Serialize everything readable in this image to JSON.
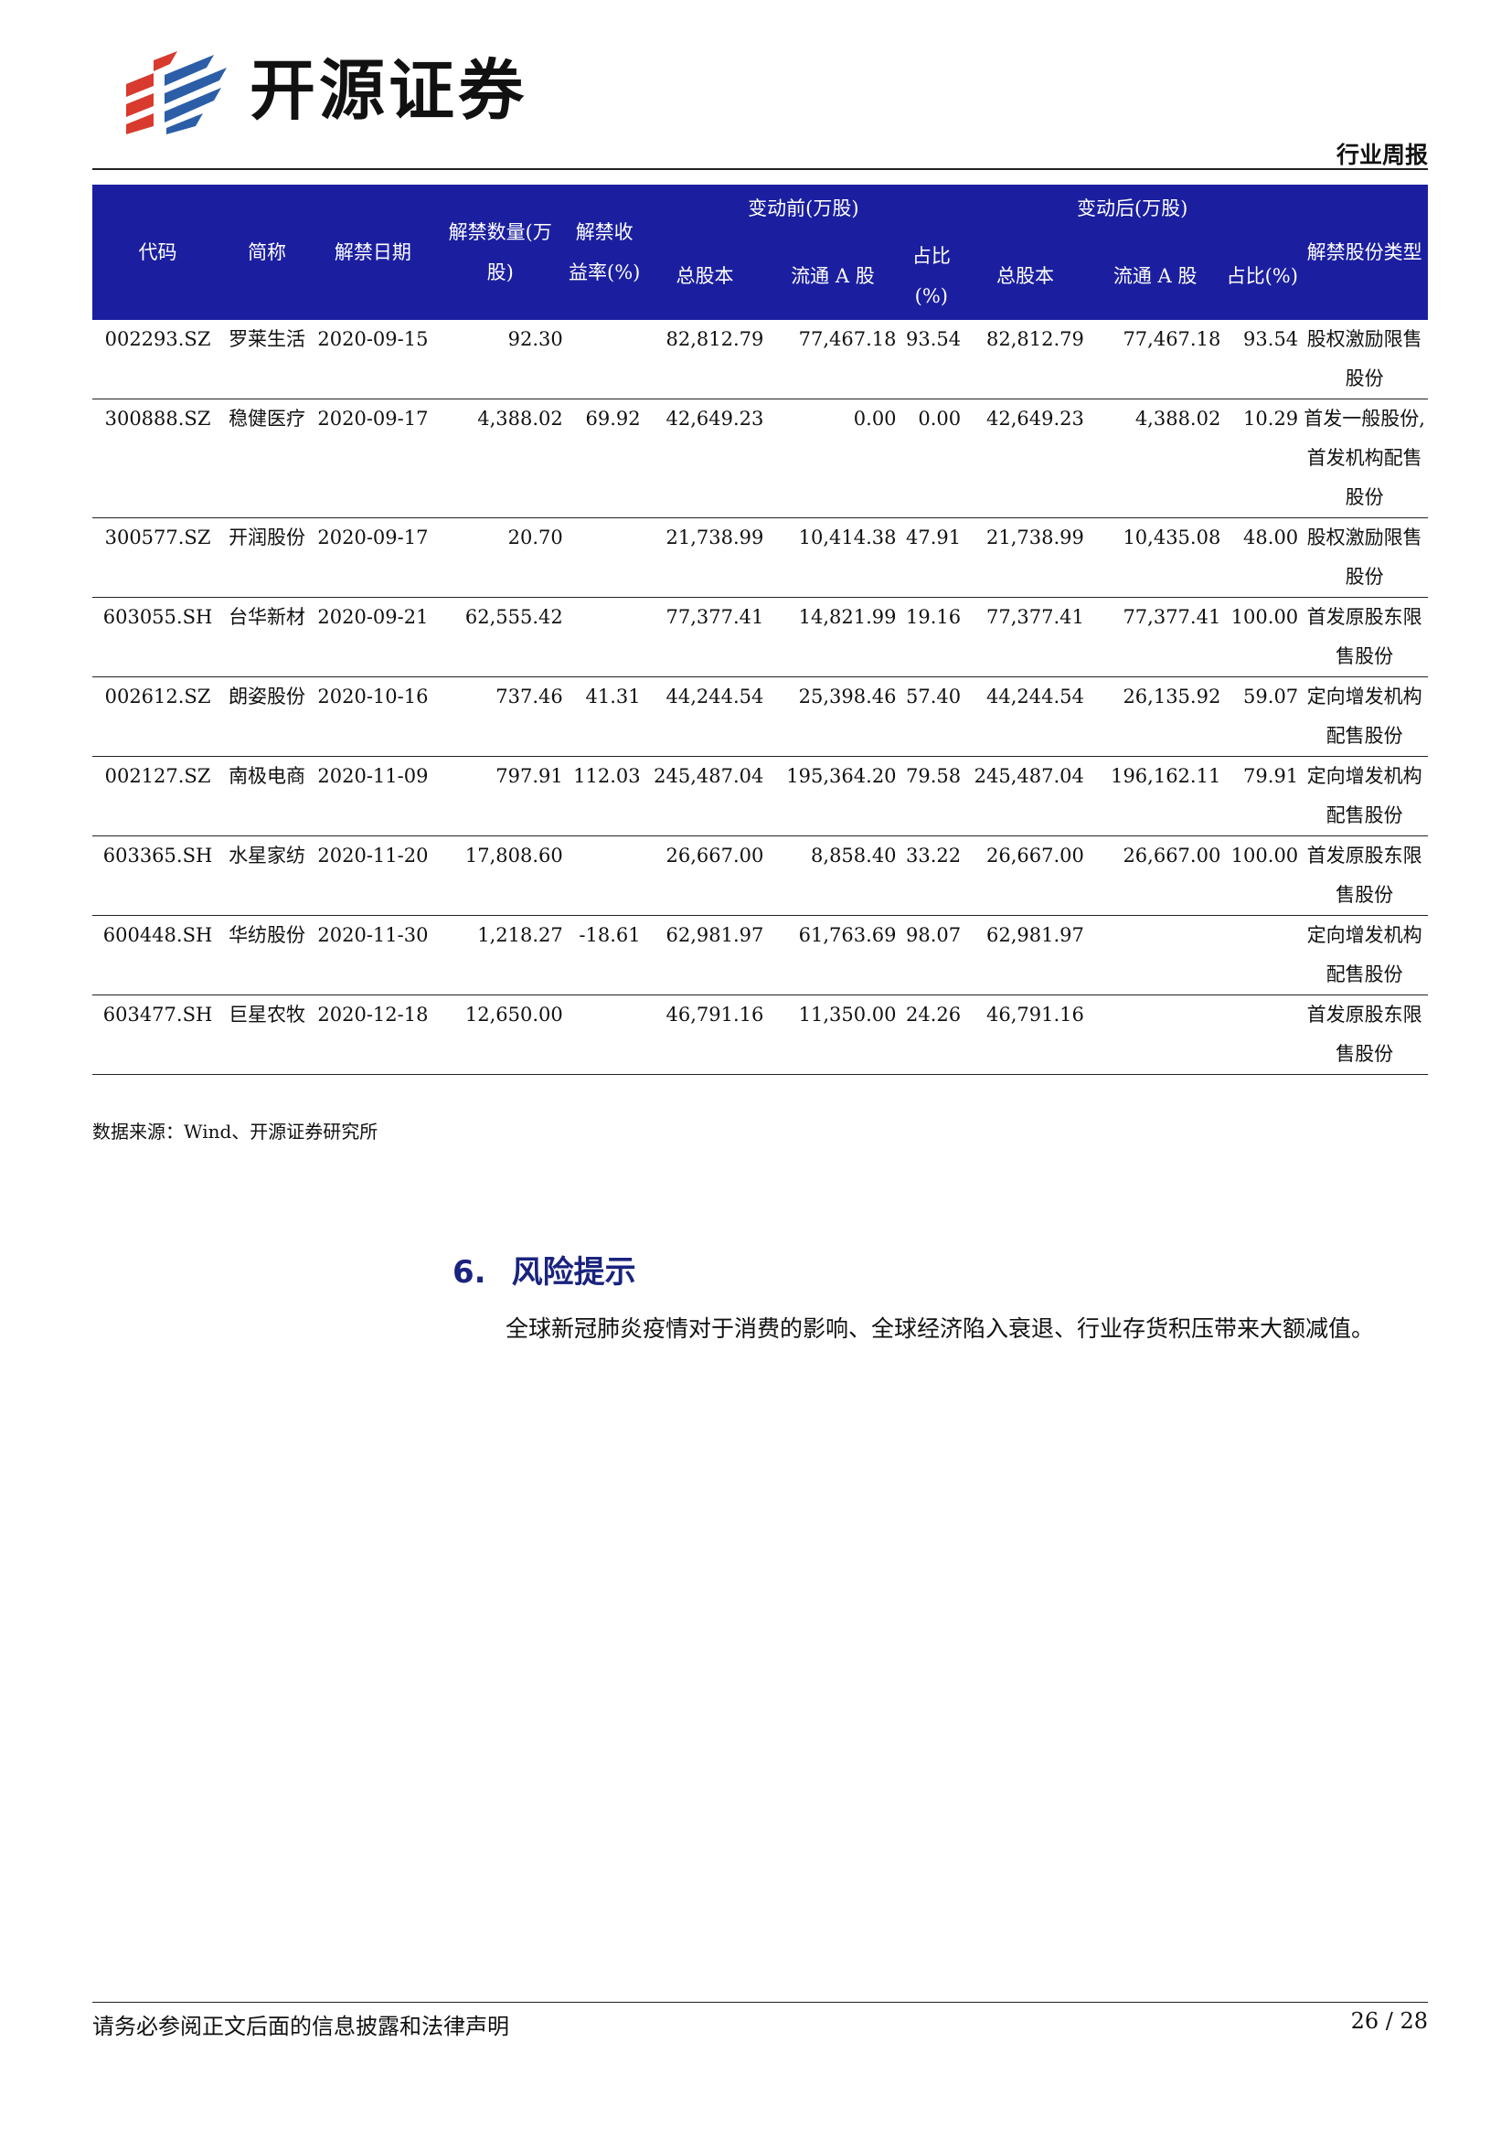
{
  "header": {
    "logo_text": "开源证券",
    "doc_type": "行业周报"
  },
  "table": {
    "group_headers": {
      "before": "变动前(万股)",
      "after": "变动后(万股)"
    },
    "columns": {
      "code": "代码",
      "name": "简称",
      "date": "解禁日期",
      "qty": "解禁数量(万股)",
      "ret": "解禁收益率(%)",
      "b_total": "总股本",
      "b_float": "流通 A 股",
      "b_ratio": "占比(%)",
      "a_total": "总股本",
      "a_float": "流通 A 股",
      "a_ratio": "占比(%)",
      "type": "解禁股份类型"
    },
    "rows": [
      {
        "code": "002293.SZ",
        "name": "罗莱生活",
        "date": "2020-09-15",
        "qty": "92.30",
        "ret": "",
        "b_total": "82,812.79",
        "b_float": "77,467.18",
        "b_ratio": "93.54",
        "a_total": "82,812.79",
        "a_float": "77,467.18",
        "a_ratio": "93.54",
        "type": "股权激励限售股份"
      },
      {
        "code": "300888.SZ",
        "name": "稳健医疗",
        "date": "2020-09-17",
        "qty": "4,388.02",
        "ret": "69.92",
        "b_total": "42,649.23",
        "b_float": "0.00",
        "b_ratio": "0.00",
        "a_total": "42,649.23",
        "a_float": "4,388.02",
        "a_ratio": "10.29",
        "type": "首发一般股份,首发机构配售股份"
      },
      {
        "code": "300577.SZ",
        "name": "开润股份",
        "date": "2020-09-17",
        "qty": "20.70",
        "ret": "",
        "b_total": "21,738.99",
        "b_float": "10,414.38",
        "b_ratio": "47.91",
        "a_total": "21,738.99",
        "a_float": "10,435.08",
        "a_ratio": "48.00",
        "type": "股权激励限售股份"
      },
      {
        "code": "603055.SH",
        "name": "台华新材",
        "date": "2020-09-21",
        "qty": "62,555.42",
        "ret": "",
        "b_total": "77,377.41",
        "b_float": "14,821.99",
        "b_ratio": "19.16",
        "a_total": "77,377.41",
        "a_float": "77,377.41",
        "a_ratio": "100.00",
        "type": "首发原股东限售股份"
      },
      {
        "code": "002612.SZ",
        "name": "朗姿股份",
        "date": "2020-10-16",
        "qty": "737.46",
        "ret": "41.31",
        "b_total": "44,244.54",
        "b_float": "25,398.46",
        "b_ratio": "57.40",
        "a_total": "44,244.54",
        "a_float": "26,135.92",
        "a_ratio": "59.07",
        "type": "定向增发机构配售股份"
      },
      {
        "code": "002127.SZ",
        "name": "南极电商",
        "date": "2020-11-09",
        "qty": "797.91",
        "ret": "112.03",
        "b_total": "245,487.04",
        "b_float": "195,364.20",
        "b_ratio": "79.58",
        "a_total": "245,487.04",
        "a_float": "196,162.11",
        "a_ratio": "79.91",
        "type": "定向增发机构配售股份"
      },
      {
        "code": "603365.SH",
        "name": "水星家纺",
        "date": "2020-11-20",
        "qty": "17,808.60",
        "ret": "",
        "b_total": "26,667.00",
        "b_float": "8,858.40",
        "b_ratio": "33.22",
        "a_total": "26,667.00",
        "a_float": "26,667.00",
        "a_ratio": "100.00",
        "type": "首发原股东限售股份"
      },
      {
        "code": "600448.SH",
        "name": "华纺股份",
        "date": "2020-11-30",
        "qty": "1,218.27",
        "ret": "-18.61",
        "b_total": "62,981.97",
        "b_float": "61,763.69",
        "b_ratio": "98.07",
        "a_total": "62,981.97",
        "a_float": "",
        "a_ratio": "",
        "type": "定向增发机构配售股份"
      },
      {
        "code": "603477.SH",
        "name": "巨星农牧",
        "date": "2020-12-18",
        "qty": "12,650.00",
        "ret": "",
        "b_total": "46,791.16",
        "b_float": "11,350.00",
        "b_ratio": "24.26",
        "a_total": "46,791.16",
        "a_float": "",
        "a_ratio": "",
        "type": "首发原股东限售股份"
      }
    ],
    "source": "数据来源：Wind、开源证券研究所"
  },
  "section": {
    "number": "6.",
    "title": "风险提示",
    "body": "全球新冠肺炎疫情对于消费的影响、全球经济陷入衰退、行业存货积压带来大额减值。"
  },
  "footer": {
    "disclaimer": "请务必参阅正文后面的信息披露和法律声明",
    "page": "26 / 28"
  },
  "colors": {
    "header_bg": "#1b1f9f",
    "title_color": "#1a237e",
    "logo_red": "#d83a2e",
    "logo_blue": "#2c5ea8"
  }
}
